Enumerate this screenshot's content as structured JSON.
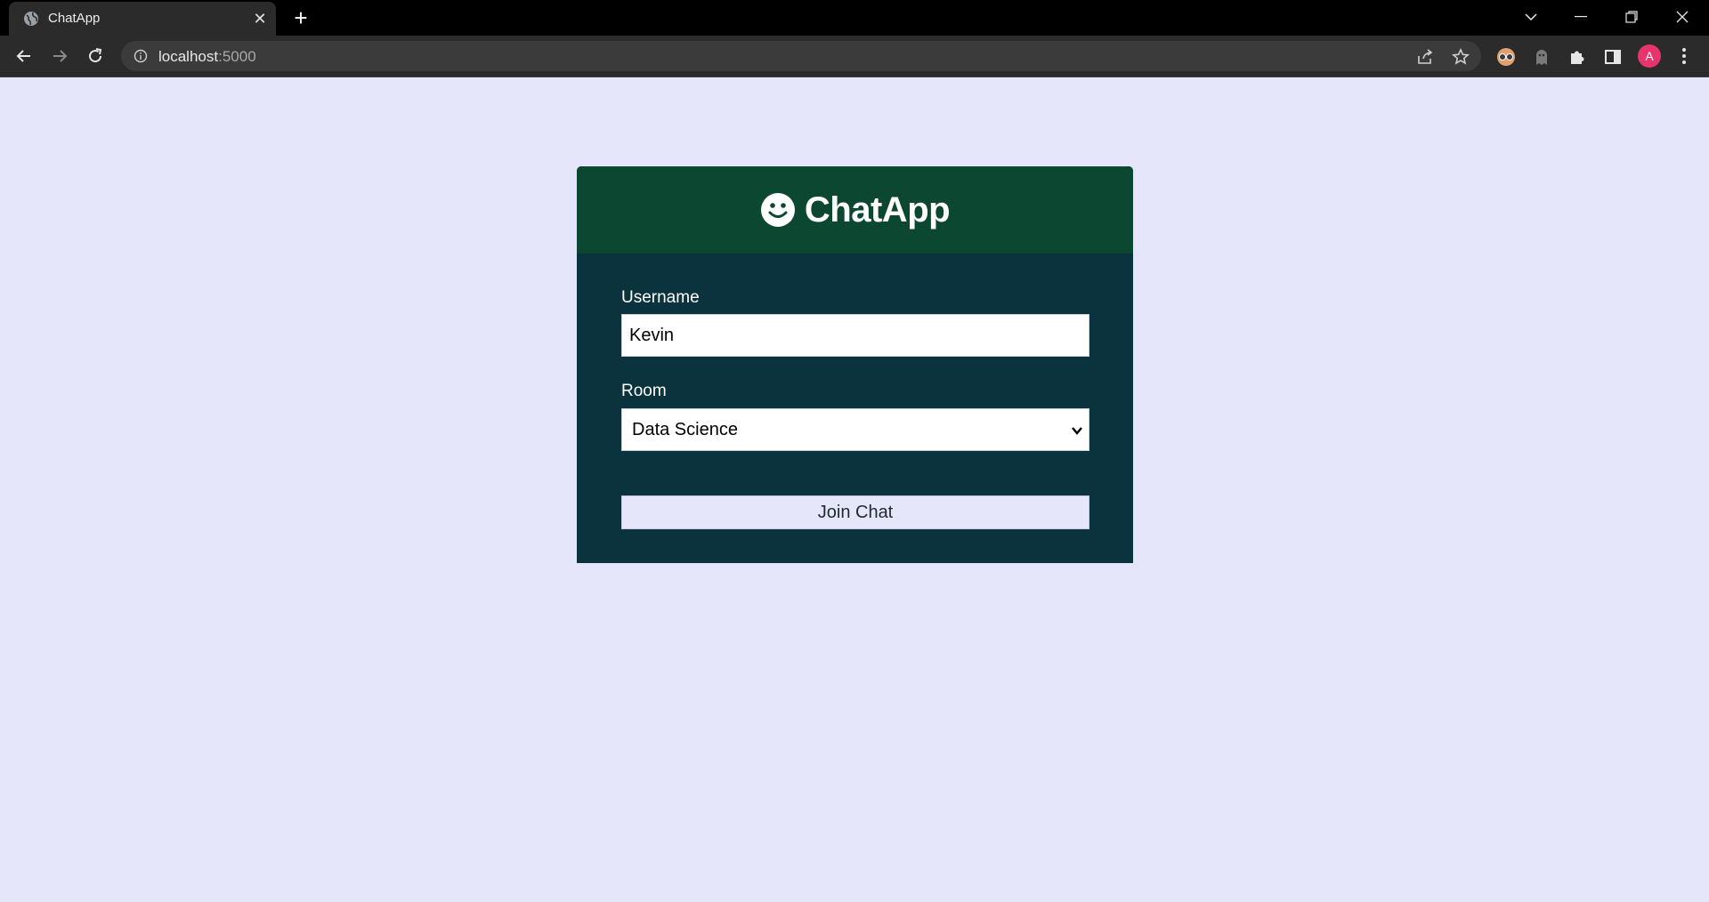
{
  "browser": {
    "tab_title": "ChatApp",
    "tab_close_glyph": "✕",
    "new_tab_glyph": "+",
    "url_host": "localhost",
    "url_port": ":5000",
    "profile_initial": "A"
  },
  "icons": {
    "favicon": "globe-icon",
    "back": "arrow-left-icon",
    "forward": "arrow-right-icon",
    "reload": "reload-icon",
    "site_info": "info-icon",
    "share": "share-icon",
    "bookmark": "star-icon",
    "extension_1": "glasses-icon",
    "extension_2": "ghost-icon",
    "extensions": "puzzle-icon",
    "side_panel": "side-panel-icon",
    "menu": "kebab-menu-icon",
    "logo": "smiley-icon"
  },
  "colors": {
    "page_background": "#e6e6fb",
    "card_body": "#0b333d",
    "card_header": "#0c4731",
    "profile_avatar": "#e8346c"
  },
  "app": {
    "title": "ChatApp",
    "username_label": "Username",
    "username_value": "Kevin",
    "room_label": "Room",
    "room_selected": "Data Science",
    "join_button": "Join Chat"
  }
}
